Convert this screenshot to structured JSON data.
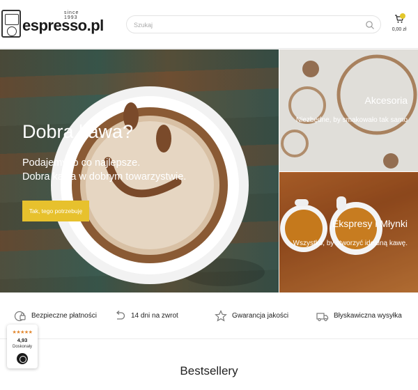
{
  "header": {
    "logo_since": "since 1993",
    "logo_text": "espresso.pl",
    "search_placeholder": "Szukaj",
    "cart_total": "0,00 zł"
  },
  "hero": {
    "title": "Dobra kawa?",
    "subtitle_line1": "Podajemy to co najlepsze.",
    "subtitle_line2": "Dobra kawa w dobrym towarzystwie.",
    "button_label": "Tak, tego potrzebuję"
  },
  "tiles": [
    {
      "title": "Akcesoria",
      "subtitle": "Niezbędne, by smakowało tak samo"
    },
    {
      "title": "Ekspresy i Młynki",
      "subtitle": "Wszystko, by stworzyć idealną kawę."
    }
  ],
  "features": [
    {
      "label": "Bezpieczne płatności",
      "icon": "secure-payment-icon"
    },
    {
      "label": "14 dni na zwrot",
      "icon": "return-arrow-icon"
    },
    {
      "label": "Gwarancja jakości",
      "icon": "star-outline-icon"
    },
    {
      "label": "Błyskawiczna wysyłka",
      "icon": "delivery-truck-icon"
    }
  ],
  "rating": {
    "stars": "★★★★★",
    "score": "4,93",
    "label": "Doskonały"
  },
  "section_title": "Bestsellery",
  "colors": {
    "accent": "#e7c12d",
    "star": "#e2862c"
  }
}
